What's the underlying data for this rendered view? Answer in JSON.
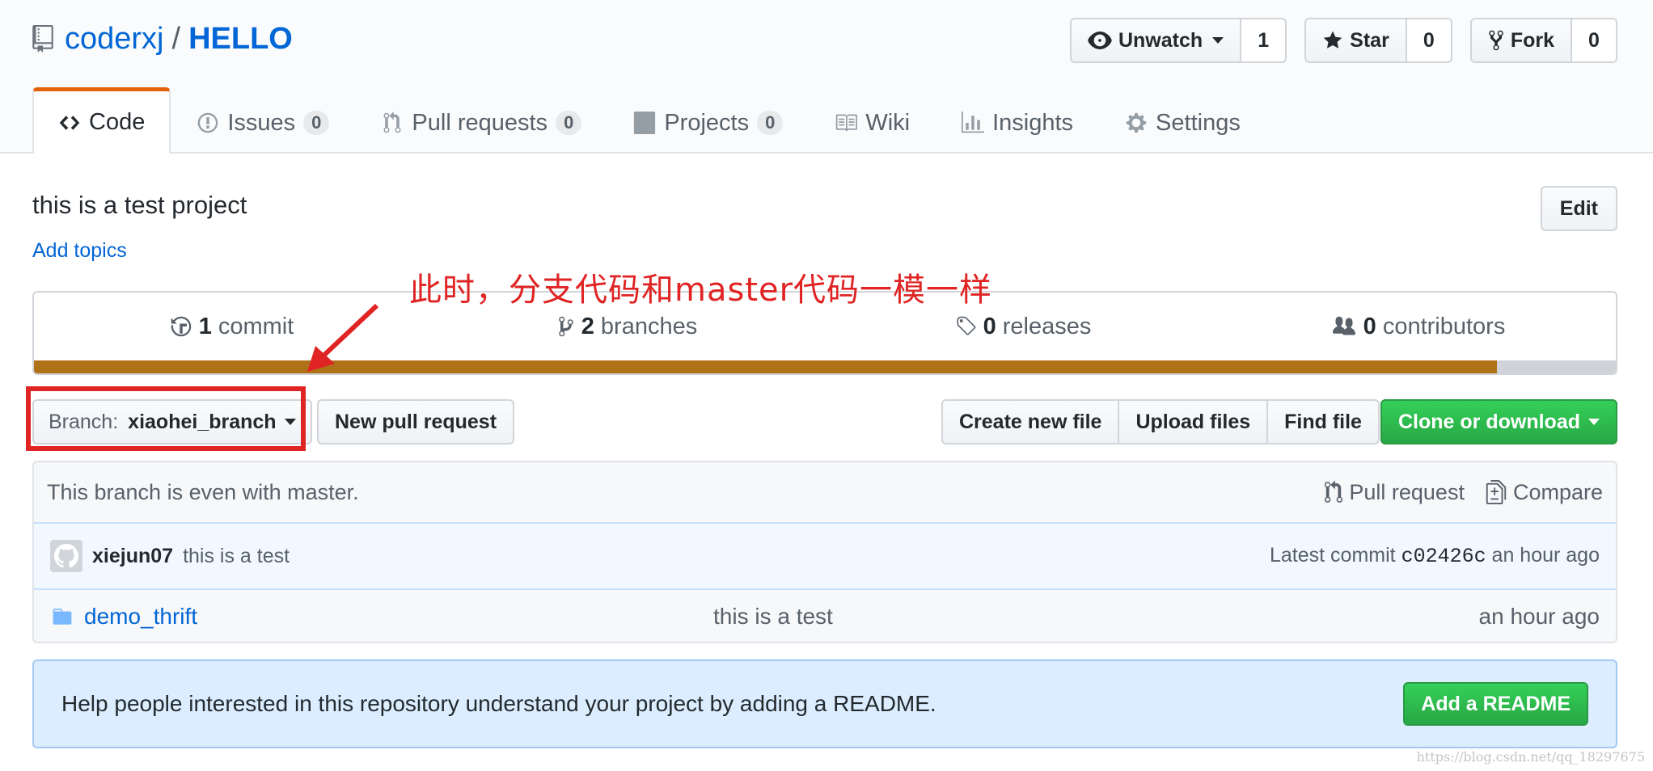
{
  "repo": {
    "owner": "coderxj",
    "separator": "/",
    "name": "HELLO"
  },
  "actions": {
    "watch_label": "Unwatch",
    "watch_count": "1",
    "star_label": "Star",
    "star_count": "0",
    "fork_label": "Fork",
    "fork_count": "0"
  },
  "nav": {
    "code": "Code",
    "issues": "Issues",
    "issues_count": "0",
    "pulls": "Pull requests",
    "pulls_count": "0",
    "projects": "Projects",
    "projects_count": "0",
    "wiki": "Wiki",
    "insights": "Insights",
    "settings": "Settings"
  },
  "description": "this is a test project",
  "add_topics": "Add topics",
  "edit_label": "Edit",
  "annotation": "此时，分支代码和master代码一模一样",
  "summary": {
    "commits_num": "1",
    "commits_label": "commit",
    "branches_num": "2",
    "branches_label": "branches",
    "releases_num": "0",
    "releases_label": "releases",
    "contributors_num": "0",
    "contributors_label": "contributors",
    "language_fill_fraction": 0.925,
    "language_color": "#b07219"
  },
  "branch": {
    "prefix": "Branch:",
    "name": "xiaohei_branch"
  },
  "new_pr_label": "New pull request",
  "file_actions": {
    "create": "Create new file",
    "upload": "Upload files",
    "find": "Find file"
  },
  "clone_label": "Clone or download",
  "infobar": {
    "message": "This branch is even with master.",
    "pull_request": "Pull request",
    "compare": "Compare"
  },
  "commit": {
    "author": "xiejun07",
    "message": "this is a test",
    "latest_label": "Latest commit",
    "sha": "c02426c",
    "age": "an hour ago"
  },
  "files": [
    {
      "name": "demo_thrift",
      "message": "this is a test",
      "age": "an hour ago"
    }
  ],
  "readme": {
    "message": "Help people interested in this repository understand your project by adding a README.",
    "button": "Add a README"
  },
  "watermark": "https://blog.csdn.net/qq_18297675",
  "colors": {
    "accent_tab": "#e36209",
    "link": "#0366d6",
    "annotation": "#e02424",
    "primary_button": "#28a745"
  }
}
